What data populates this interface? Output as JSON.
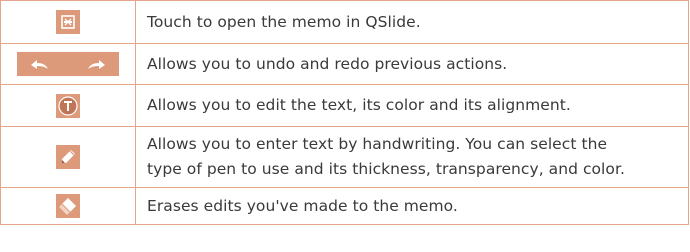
{
  "rows": [
    {
      "icon": "qslide-icon",
      "text": "Touch to open the memo in QSlide."
    },
    {
      "icon": "undo-redo-icon",
      "text": "Allows you to undo and redo previous actions."
    },
    {
      "icon": "text-edit-icon",
      "text": "Allows you to edit the text, its color and its alignment."
    },
    {
      "icon": "pen-icon",
      "text_line1": "Allows you to enter text by handwriting. You can select the",
      "text_line2": "type of pen to use and its thickness, transparency, and color."
    },
    {
      "icon": "eraser-icon",
      "text": "Erases edits you've made to the memo."
    }
  ],
  "colors": {
    "border": "#e3a68a",
    "icon_bg": "#dc9a7a",
    "icon_dark_bg": "#c98363",
    "text": "#3a3a3a"
  }
}
